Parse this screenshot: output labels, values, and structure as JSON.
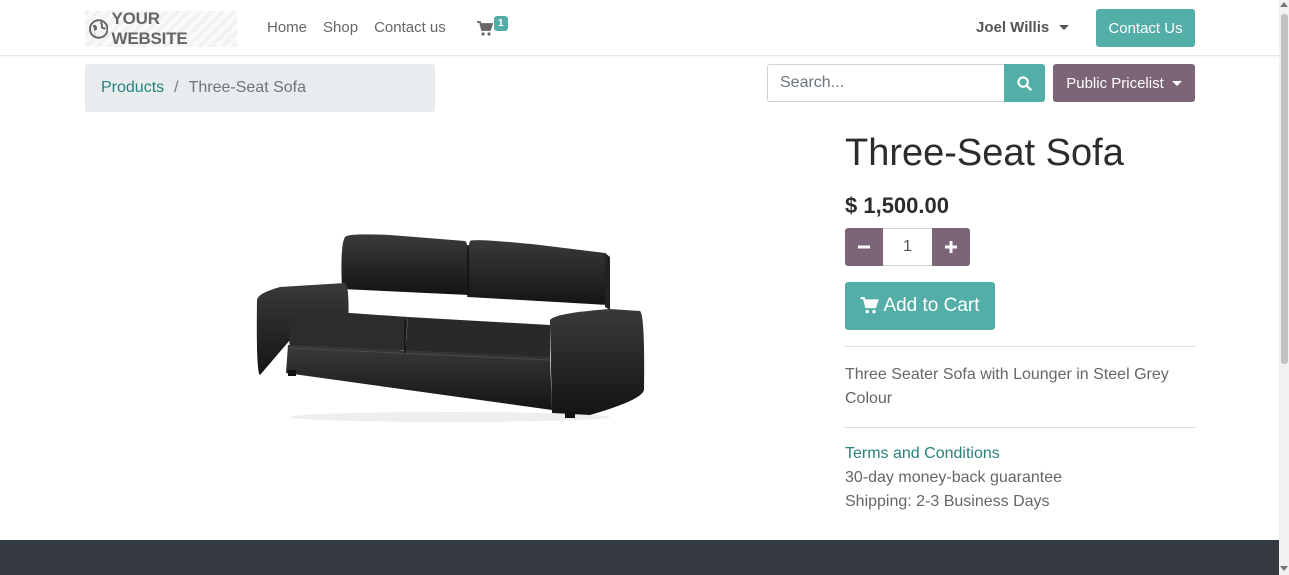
{
  "header": {
    "logo_text": "YOUR WEBSITE",
    "nav": [
      "Home",
      "Shop",
      "Contact us"
    ],
    "cart_count": "1",
    "user_name": "Joel Willis",
    "contact_button": "Contact Us"
  },
  "breadcrumb": {
    "parent": "Products",
    "separator": "/",
    "current": "Three-Seat Sofa"
  },
  "search": {
    "placeholder": "Search..."
  },
  "pricelist": {
    "label": "Public Pricelist"
  },
  "product": {
    "title": "Three-Seat Sofa",
    "price": "$ 1,500.00",
    "quantity": "1",
    "add_to_cart": "Add to Cart",
    "description": "Three Seater Sofa with Lounger in Steel Grey Colour",
    "terms_link": "Terms and Conditions",
    "guarantee": "30-day money-back guarantee",
    "shipping": "Shipping: 2-3 Business Days"
  },
  "colors": {
    "primary": "#52aea6",
    "secondary": "#7c6576",
    "link": "#29817a",
    "footer": "#343a40"
  }
}
